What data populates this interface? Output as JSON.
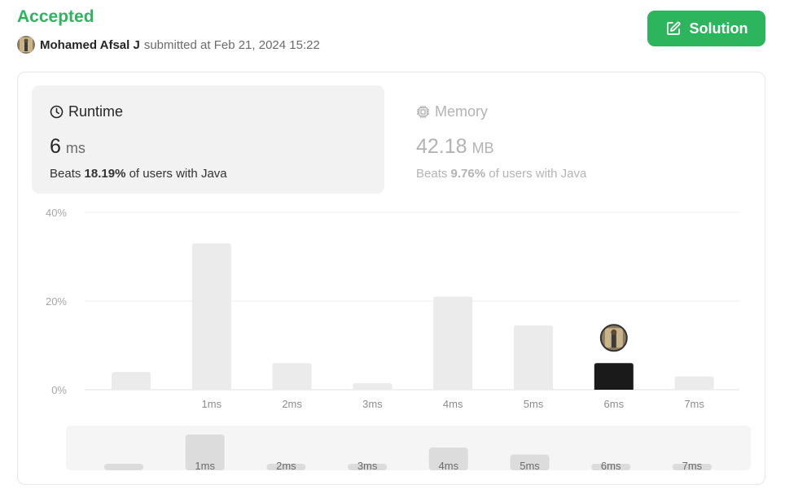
{
  "status": "Accepted",
  "submission": {
    "author": "Mohamed Afsal J",
    "submitted_text": "submitted at Feb 21, 2024 15:22"
  },
  "solution_button": {
    "label": "Solution",
    "icon": "edit-icon"
  },
  "runtime": {
    "label": "Runtime",
    "icon": "clock-icon",
    "value": "6",
    "unit": "ms",
    "beats_prefix": "Beats",
    "beats_pct": "18.19%",
    "beats_suffix": "of users with Java"
  },
  "memory": {
    "label": "Memory",
    "icon": "chip-icon",
    "value": "42.18",
    "unit": "MB",
    "beats_prefix": "Beats",
    "beats_pct": "9.76%",
    "beats_suffix": "of users with Java"
  },
  "colors": {
    "accent": "#2db55d",
    "bar": "#ebebeb",
    "bar_highlight": "#1a1a1a",
    "overview_bar": "#dcdcdc"
  },
  "chart_data": {
    "type": "bar",
    "categories": [
      "",
      "1ms",
      "2ms",
      "3ms",
      "4ms",
      "5ms",
      "6ms",
      "7ms"
    ],
    "values": [
      4,
      33,
      6,
      1.5,
      21,
      14.5,
      6,
      3
    ],
    "highlight_index": 6,
    "ylim": [
      0,
      40
    ],
    "yticks": [
      "0%",
      "20%",
      "40%"
    ],
    "overview_values": [
      4,
      33,
      6,
      1.5,
      21,
      14.5,
      6,
      3
    ]
  }
}
